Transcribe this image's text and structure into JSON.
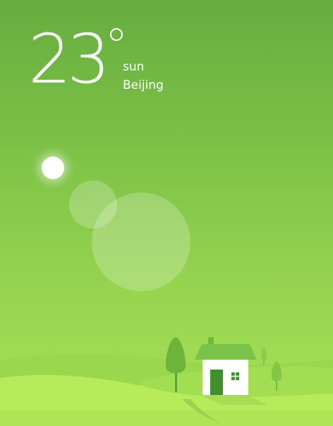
{
  "weather": {
    "temperature": "23",
    "condition": "sun",
    "city": "Beijing"
  },
  "icons": {
    "sun": "sun-icon",
    "house": "house-icon",
    "trees": "tree-icon"
  },
  "colors": {
    "sky_top": "#66ad40",
    "sky_bottom": "#a9e257",
    "hill": "#b6ec5a",
    "tree": "#6cb43a",
    "house_roof": "#7ac24a",
    "house_door": "#3f8f2a"
  }
}
